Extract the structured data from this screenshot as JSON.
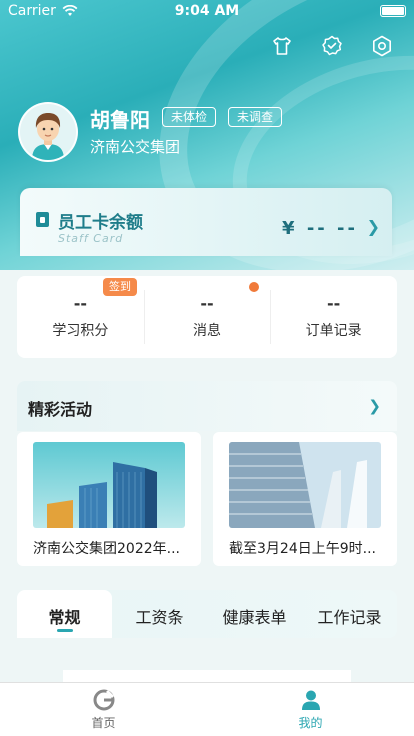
{
  "status_bar": {
    "carrier": "Carrier",
    "time": "9:04 AM"
  },
  "top_actions": [
    {
      "icon": "shirt-icon"
    },
    {
      "icon": "verified-badge-icon"
    },
    {
      "icon": "settings-icon"
    }
  ],
  "profile": {
    "name": "胡鲁阳",
    "badges": [
      "未体检",
      "未调查"
    ],
    "company": "济南公交集团"
  },
  "staff_card": {
    "title": "员工卡余额",
    "subtitle": "Staff Card",
    "amount": "¥ -- --"
  },
  "stats": [
    {
      "value": "--",
      "label": "学习积分"
    },
    {
      "value": "--",
      "label": "消息"
    },
    {
      "value": "--",
      "label": "订单记录"
    }
  ],
  "sign_in_tag": "签到",
  "activities": {
    "title": "精彩活动",
    "items": [
      {
        "caption": "济南公交集团2022年..."
      },
      {
        "caption": "截至3月24日上午9时..."
      }
    ]
  },
  "tabs": [
    {
      "label": "常规",
      "active": true
    },
    {
      "label": "工资条",
      "active": false
    },
    {
      "label": "健康表单",
      "active": false
    },
    {
      "label": "工作记录",
      "active": false
    }
  ],
  "bottom_nav": [
    {
      "label": "首页",
      "active": false
    },
    {
      "label": "我的",
      "active": true
    }
  ],
  "colors": {
    "accent": "#2aa6b1",
    "tag_orange": "#f58a4a",
    "nav_active": "#2aa6b1",
    "nav_inactive": "#666666"
  }
}
